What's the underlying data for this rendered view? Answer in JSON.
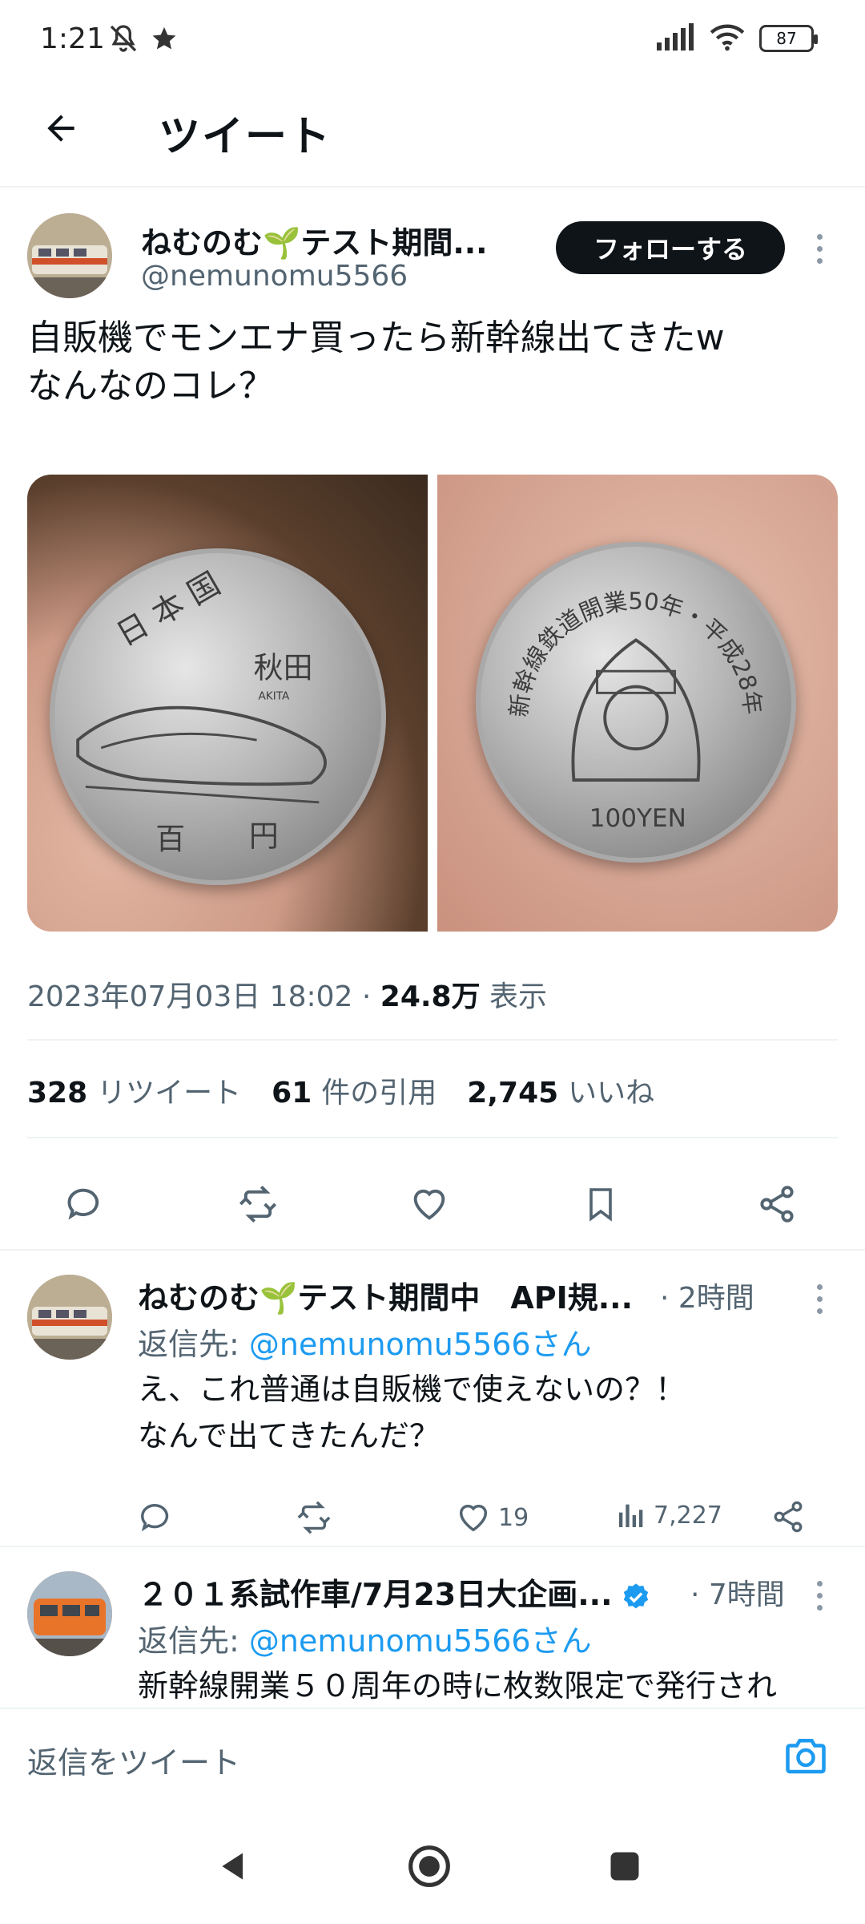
{
  "status_bar": {
    "time": "1:21",
    "battery": "87"
  },
  "header": {
    "title": "ツイート"
  },
  "tweet": {
    "author_name": "ねむのむ🌱テスト期間...",
    "author_handle": "@nemunomu5566",
    "follow_label": "フォローする",
    "text_line1": "自販機でモンエナ買ったら新幹線出てきたw",
    "text_line2": "なんなのコレ？",
    "coin_left_text": {
      "top": "日 本 国",
      "pref": "秋田",
      "pref_roman": "AKITA",
      "denom1": "百",
      "denom2": "円"
    },
    "coin_right_text": {
      "arc": "新幹線鉄道開業50年・平成28年・",
      "value": "100YEN"
    },
    "timestamp": "2023年07月03日 18:02",
    "views_sep": " · ",
    "views_count": "24.8万",
    "views_label": " 表示",
    "stats": {
      "retweets_count": "328",
      "retweets_label": "リツイート",
      "quotes_count": "61",
      "quotes_label": "件の引用",
      "likes_count": "2,745",
      "likes_label": "いいね"
    }
  },
  "replies": [
    {
      "name": "ねむのむ🌱テスト期間中　API規...",
      "time": "· 2時間",
      "reply_to_prefix": "返信先: ",
      "reply_to_mention": "@nemunomu5566さん",
      "text_line1": "え、これ普通は自販機で使えないの？！",
      "text_line2": "なんで出てきたんだ？",
      "likes": "19",
      "views": "7,227"
    },
    {
      "name": "２０１系試作車/7月23日大企画...",
      "time": "· 7時間",
      "reply_to_prefix": "返信先: ",
      "reply_to_mention": "@nemunomu5566さん",
      "text_line1": "新幹線開業５０周年の時に枚数限定で発行され"
    }
  ],
  "compose": {
    "placeholder": "返信をツイート"
  },
  "colors": {
    "accent": "#1d9bf0",
    "text": "#0f1419",
    "secondary": "#536471",
    "divider": "#eff3f4"
  }
}
